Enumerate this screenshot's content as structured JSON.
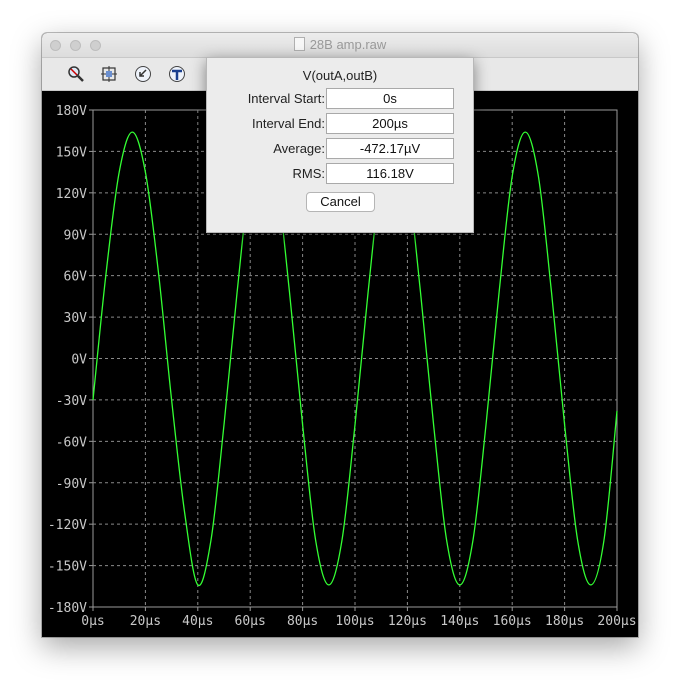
{
  "window": {
    "title": "28B amp.raw"
  },
  "toolbar": {
    "icons": [
      "zoom-icon",
      "autorange-icon",
      "pan-back-icon",
      "measure-icon"
    ]
  },
  "dialog": {
    "title": "V(outA,outB)",
    "rows": [
      {
        "label": "Interval Start:",
        "value": "0s"
      },
      {
        "label": "Interval End:",
        "value": "200µs"
      },
      {
        "label": "Average:",
        "value": "-472.17µV"
      },
      {
        "label": "RMS:",
        "value": "116.18V"
      }
    ],
    "cancel_label": "Cancel"
  },
  "chart_data": {
    "type": "line",
    "xlim": [
      0,
      200
    ],
    "ylim": [
      -180,
      180
    ],
    "xticks": [
      "0µs",
      "20µs",
      "40µs",
      "60µs",
      "80µs",
      "100µs",
      "120µs",
      "140µs",
      "160µs",
      "180µs",
      "200µs"
    ],
    "yticks": [
      "180V",
      "150V",
      "120V",
      "90V",
      "60V",
      "30V",
      "0V",
      "-30V",
      "-60V",
      "-90V",
      "-120V",
      "-150V",
      "-180V"
    ],
    "grid": true,
    "series": [
      {
        "color": "#33ff33",
        "x": [
          0,
          5,
          10,
          15,
          20,
          25,
          30,
          35,
          40,
          45,
          50,
          55,
          60,
          65,
          70,
          75,
          80,
          85,
          90,
          95,
          100,
          105,
          110,
          115,
          120,
          125,
          130,
          135,
          140,
          145,
          150,
          155,
          160,
          165,
          170,
          175,
          180,
          185,
          190,
          195,
          200
        ],
        "y": [
          -30,
          62,
          135,
          164,
          135,
          62,
          -30,
          -112,
          -164,
          -132,
          -48,
          48,
          132,
          164,
          132,
          48,
          -48,
          -132,
          -164,
          -132,
          -48,
          48,
          132,
          164,
          132,
          48,
          -48,
          -132,
          -164,
          -132,
          -48,
          48,
          132,
          164,
          132,
          48,
          -48,
          -132,
          -164,
          -132,
          -38
        ]
      }
    ]
  }
}
